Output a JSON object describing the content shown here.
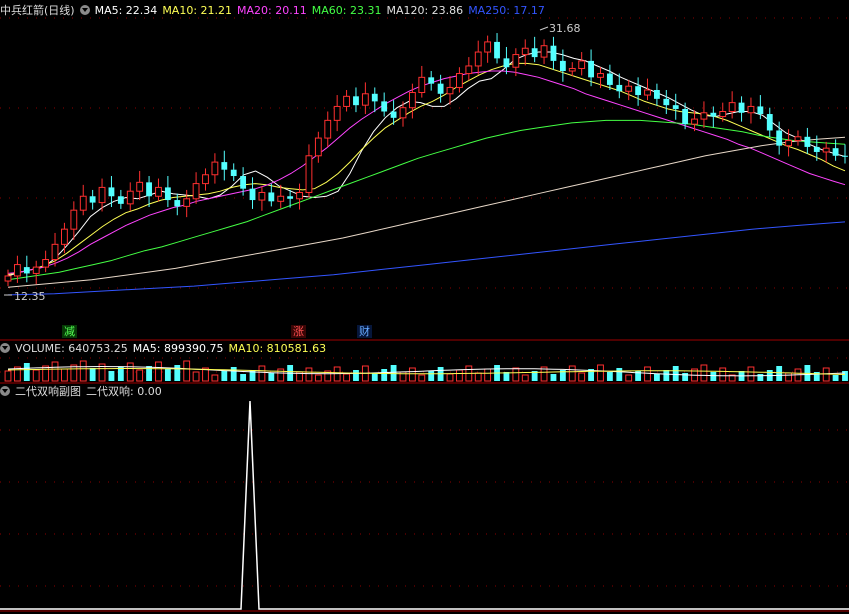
{
  "header": {
    "stock_name": "中兵红箭(日线)",
    "ma": [
      {
        "label": "MA5: 22.34",
        "color": "#ffffff"
      },
      {
        "label": "MA10: 21.21",
        "color": "#ffff55"
      },
      {
        "label": "MA20: 20.11",
        "color": "#ff44ff"
      },
      {
        "label": "MA60: 23.31",
        "color": "#44ff44"
      },
      {
        "label": "MA120: 23.86",
        "color": "#e0e0e0"
      },
      {
        "label": "MA250: 17.17",
        "color": "#3355ff"
      }
    ]
  },
  "volume_header": {
    "title": "VOLUME: 640753.25",
    "ma5": "MA5: 899390.75",
    "ma10": "MA10: 810581.63",
    "ma10_color": "#ffff55"
  },
  "indicator_header": {
    "title": "二代双响副图",
    "value": "二代双响: 0.00"
  },
  "annotations": {
    "high": "31.68",
    "low": "12.35",
    "tag_jian": "减",
    "tag_zhang": "涨",
    "tag_cai": "财"
  },
  "colors": {
    "up": "#ff3030",
    "down": "#54ffff",
    "grid": "#8b0000"
  },
  "chart_data": {
    "type": "candlestick",
    "price_range_approx": [
      12.35,
      31.68
    ],
    "candles": [
      {
        "o": 12.5,
        "c": 12.9
      },
      {
        "o": 12.9,
        "c": 13.8
      },
      {
        "o": 13.6,
        "c": 13.1
      },
      {
        "o": 13.1,
        "c": 13.6
      },
      {
        "o": 13.6,
        "c": 14.2
      },
      {
        "o": 14.2,
        "c": 15.4
      },
      {
        "o": 15.4,
        "c": 16.6
      },
      {
        "o": 16.6,
        "c": 18.1
      },
      {
        "o": 18.1,
        "c": 19.2
      },
      {
        "o": 19.2,
        "c": 18.7
      },
      {
        "o": 18.7,
        "c": 19.9
      },
      {
        "o": 19.9,
        "c": 19.2
      },
      {
        "o": 19.2,
        "c": 18.6
      },
      {
        "o": 18.6,
        "c": 19.6
      },
      {
        "o": 19.6,
        "c": 20.3
      },
      {
        "o": 20.3,
        "c": 19.2
      },
      {
        "o": 19.2,
        "c": 19.9
      },
      {
        "o": 19.9,
        "c": 18.9
      },
      {
        "o": 18.9,
        "c": 18.4
      },
      {
        "o": 18.4,
        "c": 19.0
      },
      {
        "o": 19.0,
        "c": 20.2
      },
      {
        "o": 20.2,
        "c": 20.9
      },
      {
        "o": 20.9,
        "c": 21.9
      },
      {
        "o": 21.9,
        "c": 21.3
      },
      {
        "o": 21.3,
        "c": 20.8
      },
      {
        "o": 20.8,
        "c": 19.8
      },
      {
        "o": 19.8,
        "c": 18.9
      },
      {
        "o": 18.9,
        "c": 19.5
      },
      {
        "o": 19.5,
        "c": 18.8
      },
      {
        "o": 18.8,
        "c": 19.2
      },
      {
        "o": 19.2,
        "c": 19.0
      },
      {
        "o": 19.0,
        "c": 19.5
      },
      {
        "o": 19.5,
        "c": 22.4
      },
      {
        "o": 22.4,
        "c": 23.8
      },
      {
        "o": 23.8,
        "c": 25.2
      },
      {
        "o": 25.2,
        "c": 26.3
      },
      {
        "o": 26.3,
        "c": 27.1
      },
      {
        "o": 27.1,
        "c": 26.4
      },
      {
        "o": 26.4,
        "c": 27.3
      },
      {
        "o": 27.3,
        "c": 26.7
      },
      {
        "o": 26.7,
        "c": 25.9
      },
      {
        "o": 25.9,
        "c": 25.4
      },
      {
        "o": 25.4,
        "c": 26.2
      },
      {
        "o": 26.2,
        "c": 27.4
      },
      {
        "o": 27.4,
        "c": 28.6
      },
      {
        "o": 28.6,
        "c": 28.1
      },
      {
        "o": 28.1,
        "c": 27.3
      },
      {
        "o": 27.3,
        "c": 27.8
      },
      {
        "o": 27.8,
        "c": 28.9
      },
      {
        "o": 28.9,
        "c": 29.5
      },
      {
        "o": 29.5,
        "c": 30.6
      },
      {
        "o": 30.6,
        "c": 31.4
      },
      {
        "o": 31.4,
        "c": 30.1
      },
      {
        "o": 30.1,
        "c": 29.4
      },
      {
        "o": 29.4,
        "c": 30.4
      },
      {
        "o": 30.4,
        "c": 30.9
      },
      {
        "o": 30.9,
        "c": 30.2
      },
      {
        "o": 30.2,
        "c": 31.1
      },
      {
        "o": 31.1,
        "c": 29.9
      },
      {
        "o": 29.9,
        "c": 29.1
      },
      {
        "o": 29.1,
        "c": 29.3
      },
      {
        "o": 29.3,
        "c": 29.9
      },
      {
        "o": 29.9,
        "c": 28.6
      },
      {
        "o": 28.6,
        "c": 28.9
      },
      {
        "o": 28.9,
        "c": 28.0
      },
      {
        "o": 28.0,
        "c": 27.5
      },
      {
        "o": 27.5,
        "c": 27.9
      },
      {
        "o": 27.9,
        "c": 27.2
      },
      {
        "o": 27.2,
        "c": 27.6
      },
      {
        "o": 27.6,
        "c": 26.9
      },
      {
        "o": 26.9,
        "c": 26.4
      },
      {
        "o": 26.4,
        "c": 26.1
      },
      {
        "o": 26.1,
        "c": 24.9
      },
      {
        "o": 24.9,
        "c": 25.3
      },
      {
        "o": 25.3,
        "c": 25.8
      },
      {
        "o": 25.8,
        "c": 25.5
      },
      {
        "o": 25.5,
        "c": 25.9
      },
      {
        "o": 25.9,
        "c": 26.6
      },
      {
        "o": 26.6,
        "c": 25.8
      },
      {
        "o": 25.8,
        "c": 26.3
      },
      {
        "o": 26.3,
        "c": 25.7
      },
      {
        "o": 25.7,
        "c": 24.4
      },
      {
        "o": 24.4,
        "c": 23.2
      },
      {
        "o": 23.2,
        "c": 23.6
      },
      {
        "o": 23.6,
        "c": 23.9
      },
      {
        "o": 23.9,
        "c": 23.1
      },
      {
        "o": 23.1,
        "c": 22.7
      },
      {
        "o": 22.7,
        "c": 23.0
      },
      {
        "o": 23.0,
        "c": 22.4
      },
      {
        "o": 22.4,
        "c": 22.34
      }
    ],
    "ma_lines": {
      "MA5": [
        12.9,
        13.2,
        13.4,
        13.6,
        14.3,
        15.3,
        16.4,
        17.6,
        18.3,
        18.8,
        19.1,
        19.0,
        19.3,
        19.6,
        19.4,
        19.3,
        19.2,
        19.0,
        19.3,
        20.0,
        20.9,
        21.2,
        20.7,
        20.0,
        19.6,
        19.2,
        19.1,
        19.2,
        19.6,
        21.0,
        22.8,
        24.3,
        25.4,
        26.2,
        26.7,
        26.6,
        26.3,
        26.3,
        26.9,
        27.7,
        28.3,
        28.5,
        29.2,
        30.0,
        30.4,
        30.6,
        30.6,
        30.4,
        30.1,
        29.9,
        29.5,
        29.1,
        28.6,
        28.2,
        27.8,
        27.4,
        27.0,
        26.5,
        26.0,
        25.6,
        25.5,
        25.7,
        25.9,
        25.9,
        25.6,
        24.9,
        24.2,
        23.8,
        23.3,
        22.9,
        22.6,
        22.34
      ],
      "MA10": [
        13.0,
        13.2,
        13.4,
        13.7,
        14.1,
        14.7,
        15.4,
        16.1,
        16.8,
        17.4,
        17.9,
        18.2,
        18.6,
        18.9,
        19.1,
        19.2,
        19.3,
        19.4,
        19.6,
        19.9,
        20.1,
        20.2,
        20.1,
        19.9,
        19.8,
        19.7,
        19.8,
        20.3,
        21.0,
        21.9,
        22.9,
        23.8,
        24.6,
        25.2,
        25.8,
        26.3,
        26.7,
        27.2,
        27.8,
        28.3,
        28.8,
        29.2,
        29.5,
        29.7,
        29.7,
        29.6,
        29.3,
        29.0,
        28.7,
        28.4,
        28.1,
        27.8,
        27.5,
        27.1,
        26.7,
        26.4,
        26.1,
        25.9,
        25.8,
        25.7,
        25.5,
        25.2,
        24.8,
        24.4,
        24.0,
        23.6,
        23.2,
        22.9,
        22.5,
        22.1,
        21.6,
        21.21
      ],
      "MA20": [
        13.1,
        13.2,
        13.4,
        13.6,
        13.9,
        14.3,
        14.8,
        15.4,
        15.9,
        16.4,
        16.9,
        17.3,
        17.7,
        18.0,
        18.3,
        18.5,
        18.8,
        19.0,
        19.2,
        19.4,
        19.6,
        19.8,
        20.1,
        20.5,
        21.0,
        21.6,
        22.3,
        23.0,
        23.8,
        24.6,
        25.3,
        25.9,
        26.5,
        27.0,
        27.5,
        27.9,
        28.2,
        28.5,
        28.7,
        28.9,
        29.0,
        29.1,
        29.1,
        29.0,
        28.8,
        28.6,
        28.3,
        28.0,
        27.7,
        27.3,
        27.0,
        26.7,
        26.4,
        26.1,
        25.8,
        25.5,
        25.2,
        24.9,
        24.6,
        24.3,
        24.0,
        23.7,
        23.3,
        23.0,
        22.6,
        22.2,
        21.8,
        21.4,
        21.0,
        20.7,
        20.4,
        20.11
      ],
      "MA60": [
        12.6,
        12.8,
        13.0,
        13.2,
        13.5,
        13.8,
        14.1,
        14.5,
        14.9,
        15.2,
        15.6,
        16.0,
        16.4,
        16.8,
        17.2,
        17.7,
        18.2,
        18.7,
        19.2,
        19.7,
        20.2,
        20.7,
        21.2,
        21.7,
        22.2,
        22.6,
        23.0,
        23.4,
        23.8,
        24.1,
        24.4,
        24.6,
        24.8,
        25.0,
        25.1,
        25.2,
        25.2,
        25.2,
        25.1,
        25.0,
        24.9,
        24.7,
        24.5,
        24.3,
        24.0,
        23.8,
        23.6,
        23.5,
        23.4,
        23.31
      ],
      "MA120": [
        12.0,
        12.2,
        12.4,
        12.6,
        12.9,
        13.2,
        13.5,
        13.9,
        14.3,
        14.7,
        15.1,
        15.5,
        15.9,
        16.4,
        16.9,
        17.4,
        17.9,
        18.4,
        18.9,
        19.4,
        19.9,
        20.4,
        20.9,
        21.4,
        21.9,
        22.4,
        22.8,
        23.2,
        23.5,
        23.7,
        23.86
      ],
      "MA250": [
        11.4,
        11.5,
        11.7,
        11.9,
        12.1,
        12.4,
        12.7,
        13.0,
        13.4,
        13.8,
        14.2,
        14.6,
        15.0,
        15.4,
        15.8,
        16.2,
        16.6,
        16.9,
        17.17
      ]
    }
  }
}
